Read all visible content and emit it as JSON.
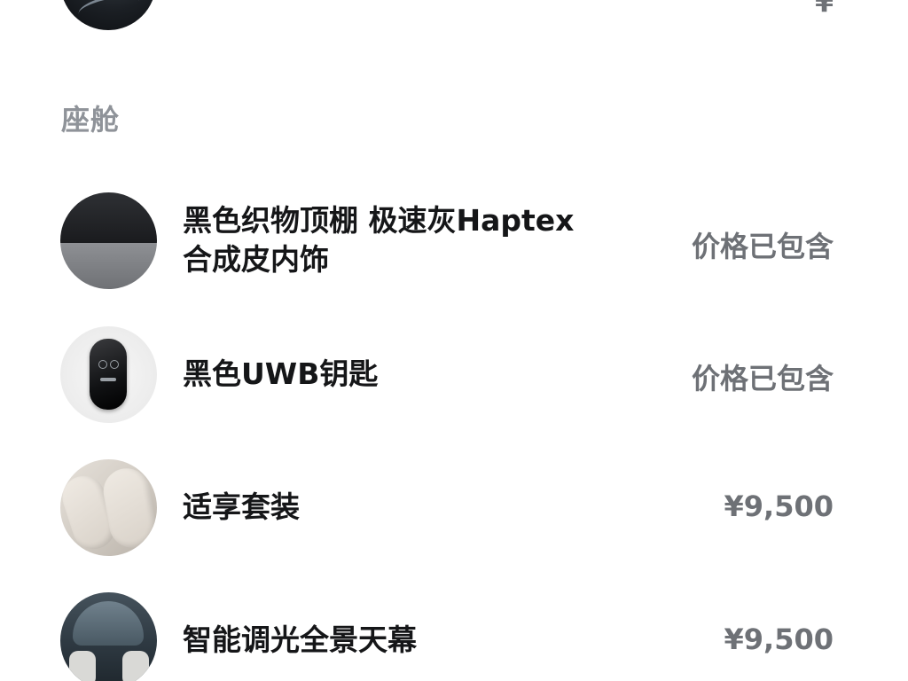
{
  "top_partial": {
    "price": "¥"
  },
  "section": {
    "title": "座舱"
  },
  "options": [
    {
      "name_line1": "黑色织物顶棚 极速灰Haptex",
      "name_line2": "合成皮内饰",
      "price": "价格已包含",
      "thumb_icon": "headliner-swatch-icon"
    },
    {
      "name_line1": "黑色UWB钥匙",
      "price": "价格已包含",
      "thumb_icon": "key-fob-icon"
    },
    {
      "name_line1": "适享套装",
      "price": "¥9,500",
      "thumb_icon": "comfort-seat-icon"
    },
    {
      "name_line1": "智能调光全景天幕",
      "price": "¥9,500",
      "thumb_icon": "panoramic-roof-icon"
    }
  ]
}
